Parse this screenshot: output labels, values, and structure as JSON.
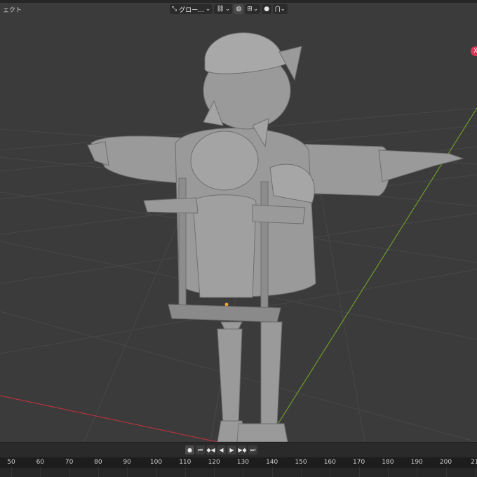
{
  "header": {
    "editor_label": "ェクト",
    "transform_orientation": "グロー...",
    "orientation_arrow": "⌄",
    "snap_icon": "🧲",
    "proportional_icon": "◎"
  },
  "gizmo": {
    "axis_label": "X"
  },
  "playback": {
    "record": "●",
    "jump_start": "⏮",
    "prev_keyframe": "◆◀",
    "play_reverse": "◀",
    "play": "▶",
    "next_keyframe": "▶◆",
    "jump_end": "⏭"
  },
  "timeline": {
    "ticks": [
      "50",
      "60",
      "70",
      "80",
      "90",
      "100",
      "110",
      "120",
      "130",
      "140",
      "150",
      "160",
      "170",
      "180",
      "190",
      "200",
      "21"
    ]
  },
  "colors": {
    "viewport_bg": "#3b3b3b",
    "grid": "#474747",
    "x_axis": "#b0343d",
    "y_axis": "#6d9a2a",
    "model": "#9b9b9b",
    "gizmo_x": "#d9365c"
  }
}
